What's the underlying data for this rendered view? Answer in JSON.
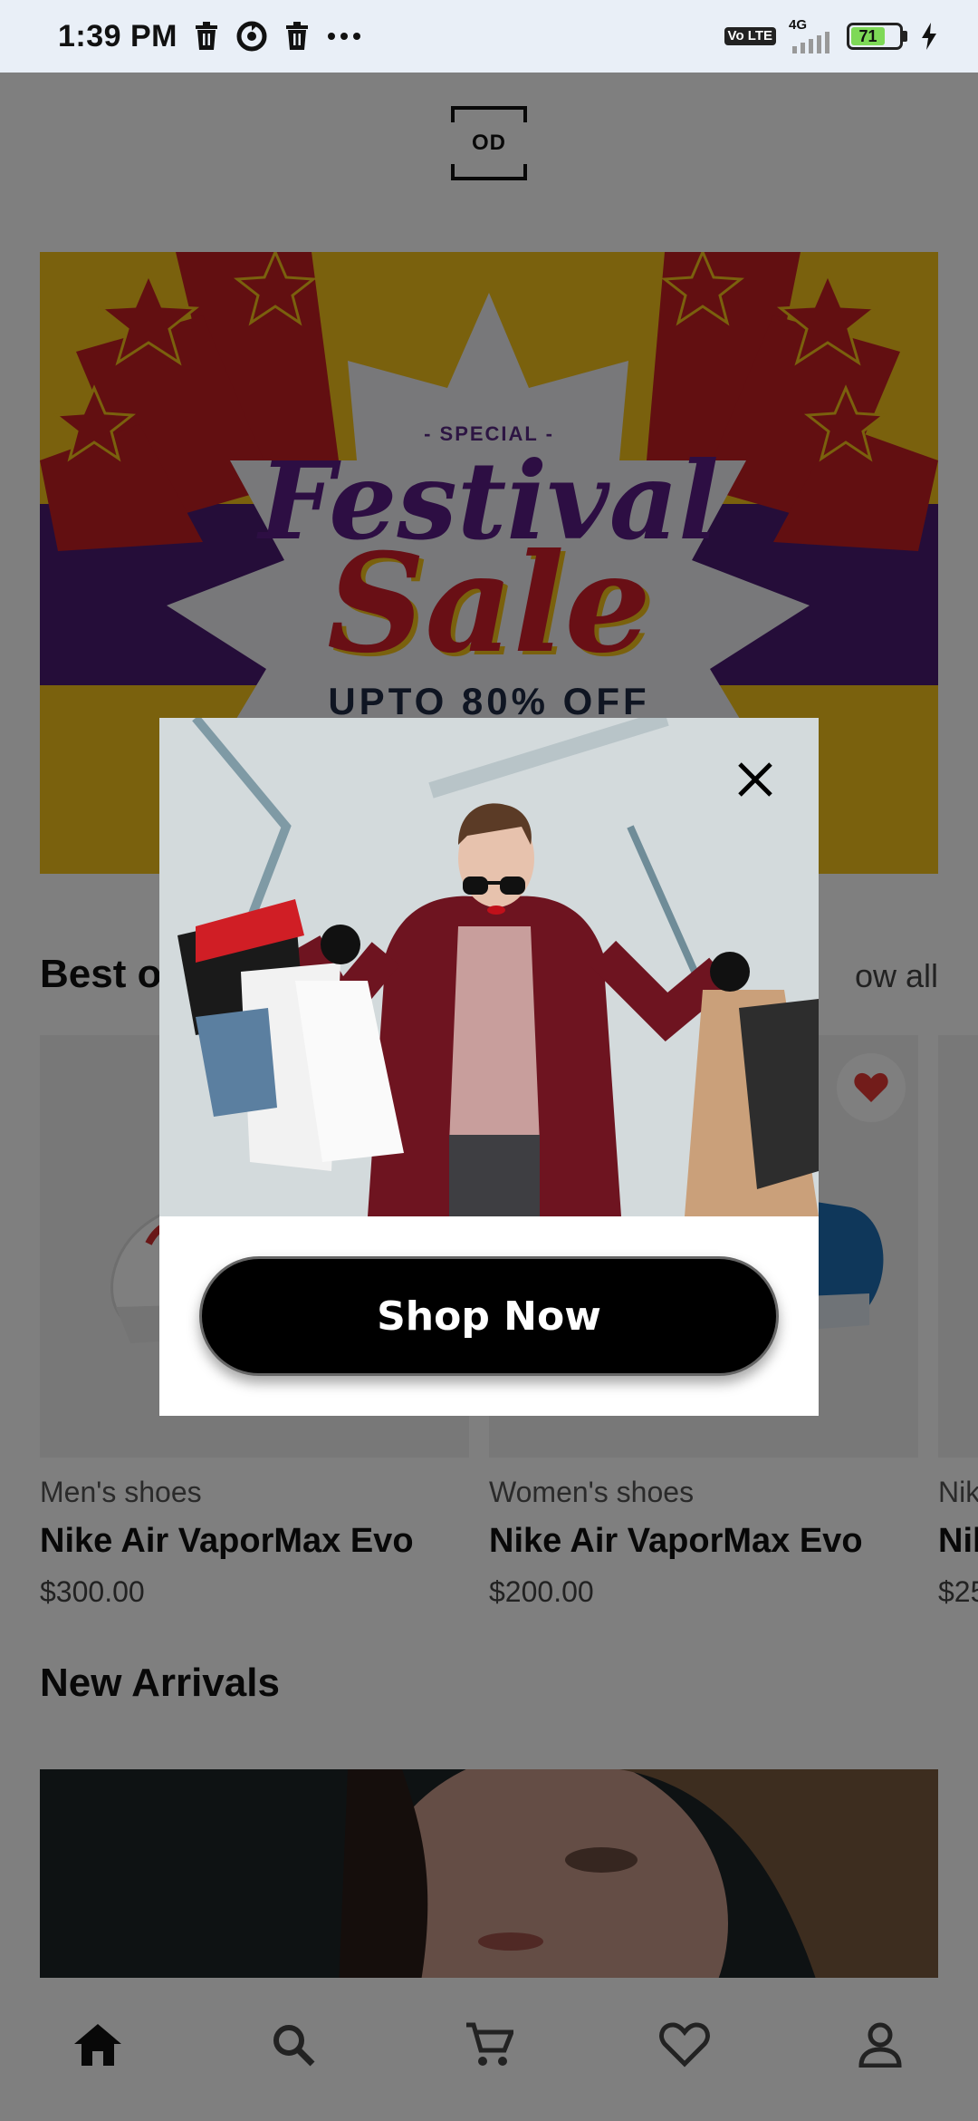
{
  "status_bar": {
    "time": "1:39 PM",
    "network": "4G",
    "volte": "Vo LTE",
    "battery": "71"
  },
  "header": {
    "logo_text": "OD"
  },
  "banner": {
    "special": "- SPECIAL -",
    "title_line1": "Festival",
    "title_line2": "Sale",
    "offer": "UPTO 80% OFF"
  },
  "best_offers": {
    "title": "Best of",
    "show_all": "ow all"
  },
  "products": [
    {
      "category": "Men's shoes",
      "name": "Nike Air VaporMax Evo",
      "price": "$300.00"
    },
    {
      "category": "Women's shoes",
      "name": "Nike Air VaporMax Evo",
      "price": "$200.00"
    },
    {
      "category": "Nik",
      "name": "Nil",
      "price": "$25"
    }
  ],
  "new_arrivals": {
    "title": "New Arrivals"
  },
  "modal": {
    "button_label": "Shop Now"
  },
  "colors": {
    "banner_yellow": "#f4c21a",
    "banner_purple": "#4a1a72",
    "banner_red": "#d21f2a",
    "favorite_red": "#e53935",
    "scrim": "rgba(0,0,0,0.5)"
  }
}
